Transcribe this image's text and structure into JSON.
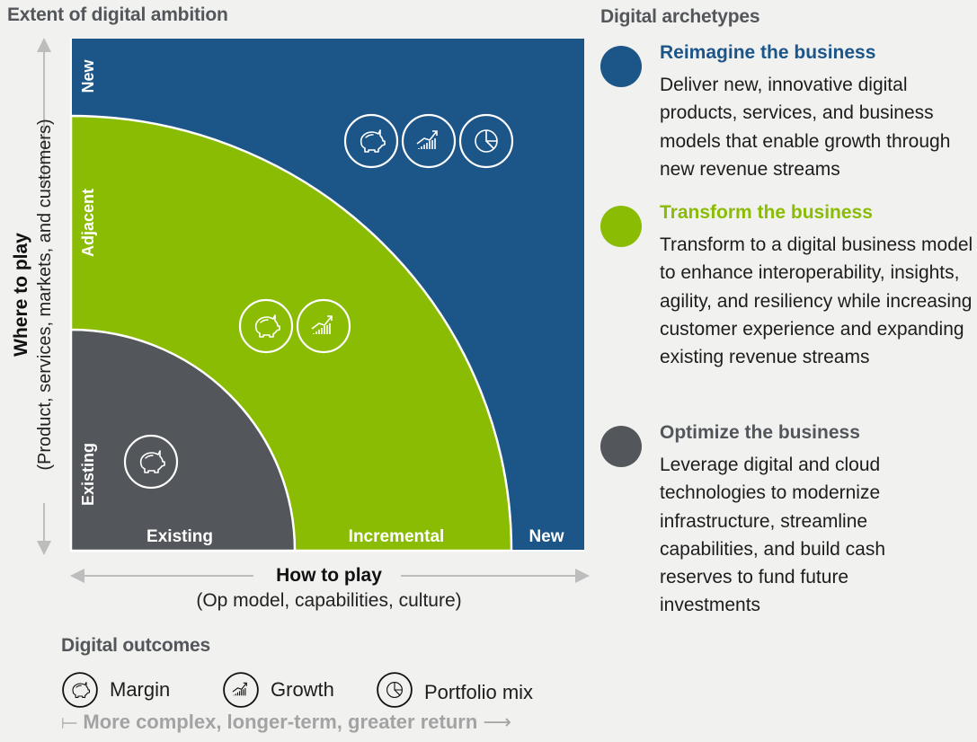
{
  "header": {
    "left_title": "Extent of digital ambition",
    "right_title": "Digital archetypes"
  },
  "colors": {
    "reimagine": "#1c5689",
    "transform": "#8bbc04",
    "optimize": "#53565a",
    "outline": "#ffffff",
    "arrow": "#bdbdbd",
    "muted_text": "#a3a3a3"
  },
  "chart_data": {
    "type": "diagram",
    "title": "Extent of digital ambition",
    "y_axis": {
      "title": "Where to play",
      "subtitle": "(Product, services, markets, and customers)",
      "levels": [
        "Existing",
        "Adjacent",
        "New"
      ]
    },
    "x_axis": {
      "title": "How to play",
      "subtitle": "(Op model, capabilities, culture)",
      "levels": [
        "Existing",
        "Incremental",
        "New"
      ]
    },
    "zones": [
      {
        "name": "Optimize the business",
        "color": "#53565a",
        "y_level": "Existing",
        "x_level": "Existing",
        "outcomes": [
          "Margin"
        ]
      },
      {
        "name": "Transform the business",
        "color": "#8bbc04",
        "y_level": "Adjacent",
        "x_level": "Incremental",
        "outcomes": [
          "Margin",
          "Growth"
        ]
      },
      {
        "name": "Reimagine the business",
        "color": "#1c5689",
        "y_level": "New",
        "x_level": "New",
        "outcomes": [
          "Margin",
          "Growth",
          "Portfolio mix"
        ]
      }
    ]
  },
  "outcomes": {
    "title": "Digital outcomes",
    "items": [
      {
        "label": "Margin",
        "icon": "piggy-bank-icon"
      },
      {
        "label": "Growth",
        "icon": "growth-chart-icon"
      },
      {
        "label": "Portfolio mix",
        "icon": "pie-chart-icon"
      }
    ],
    "scale_note": "More complex, longer-term, greater return"
  },
  "archetypes": [
    {
      "title": "Reimagine the business",
      "color": "#1c5689",
      "description": "Deliver new, innovative digital products, services, and business models that enable growth through new revenue streams"
    },
    {
      "title": "Transform the business",
      "color": "#8bbc04",
      "description": "Transform to a digital business model to enhance interoperability, insights, agility, and resiliency while increasing customer experience and expanding existing revenue streams"
    },
    {
      "title": "Optimize the business",
      "color": "#53565a",
      "description": "Leverage digital and cloud technologies to modernize infrastructure, streamline capabilities, and build cash reserves to fund future investments"
    }
  ]
}
